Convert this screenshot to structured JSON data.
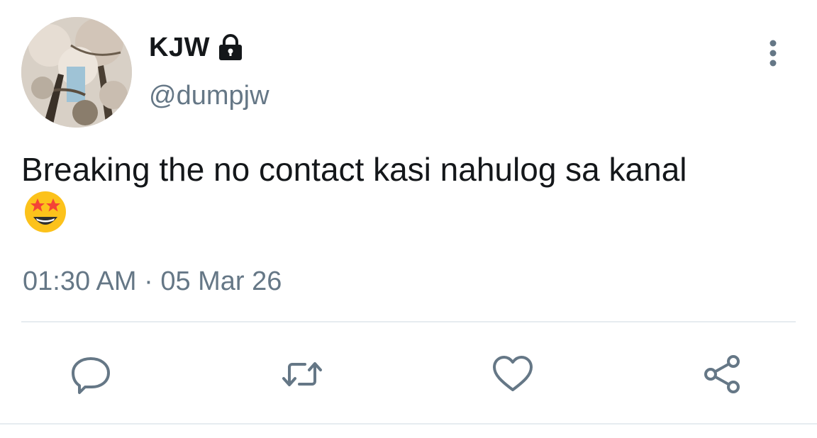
{
  "tweet": {
    "author": {
      "display_name": "KJW",
      "handle": "@dumpjw",
      "protected_icon": "lock-icon",
      "avatar_icon": "avatar"
    },
    "text": "Breaking the no contact kasi nahulog sa kanal",
    "emoji": "star-struck-emoji",
    "timestamp": "01:30 AM · 05 Mar 26"
  },
  "actions": [
    {
      "icon": "reply-icon"
    },
    {
      "icon": "retweet-icon"
    },
    {
      "icon": "like-icon"
    },
    {
      "icon": "share-icon"
    }
  ],
  "menu": {
    "icon": "more-options-icon"
  },
  "colors": {
    "primary_text": "#14171a",
    "secondary_text": "#657786",
    "divider": "#e6ecf0",
    "icon": "#657786"
  }
}
